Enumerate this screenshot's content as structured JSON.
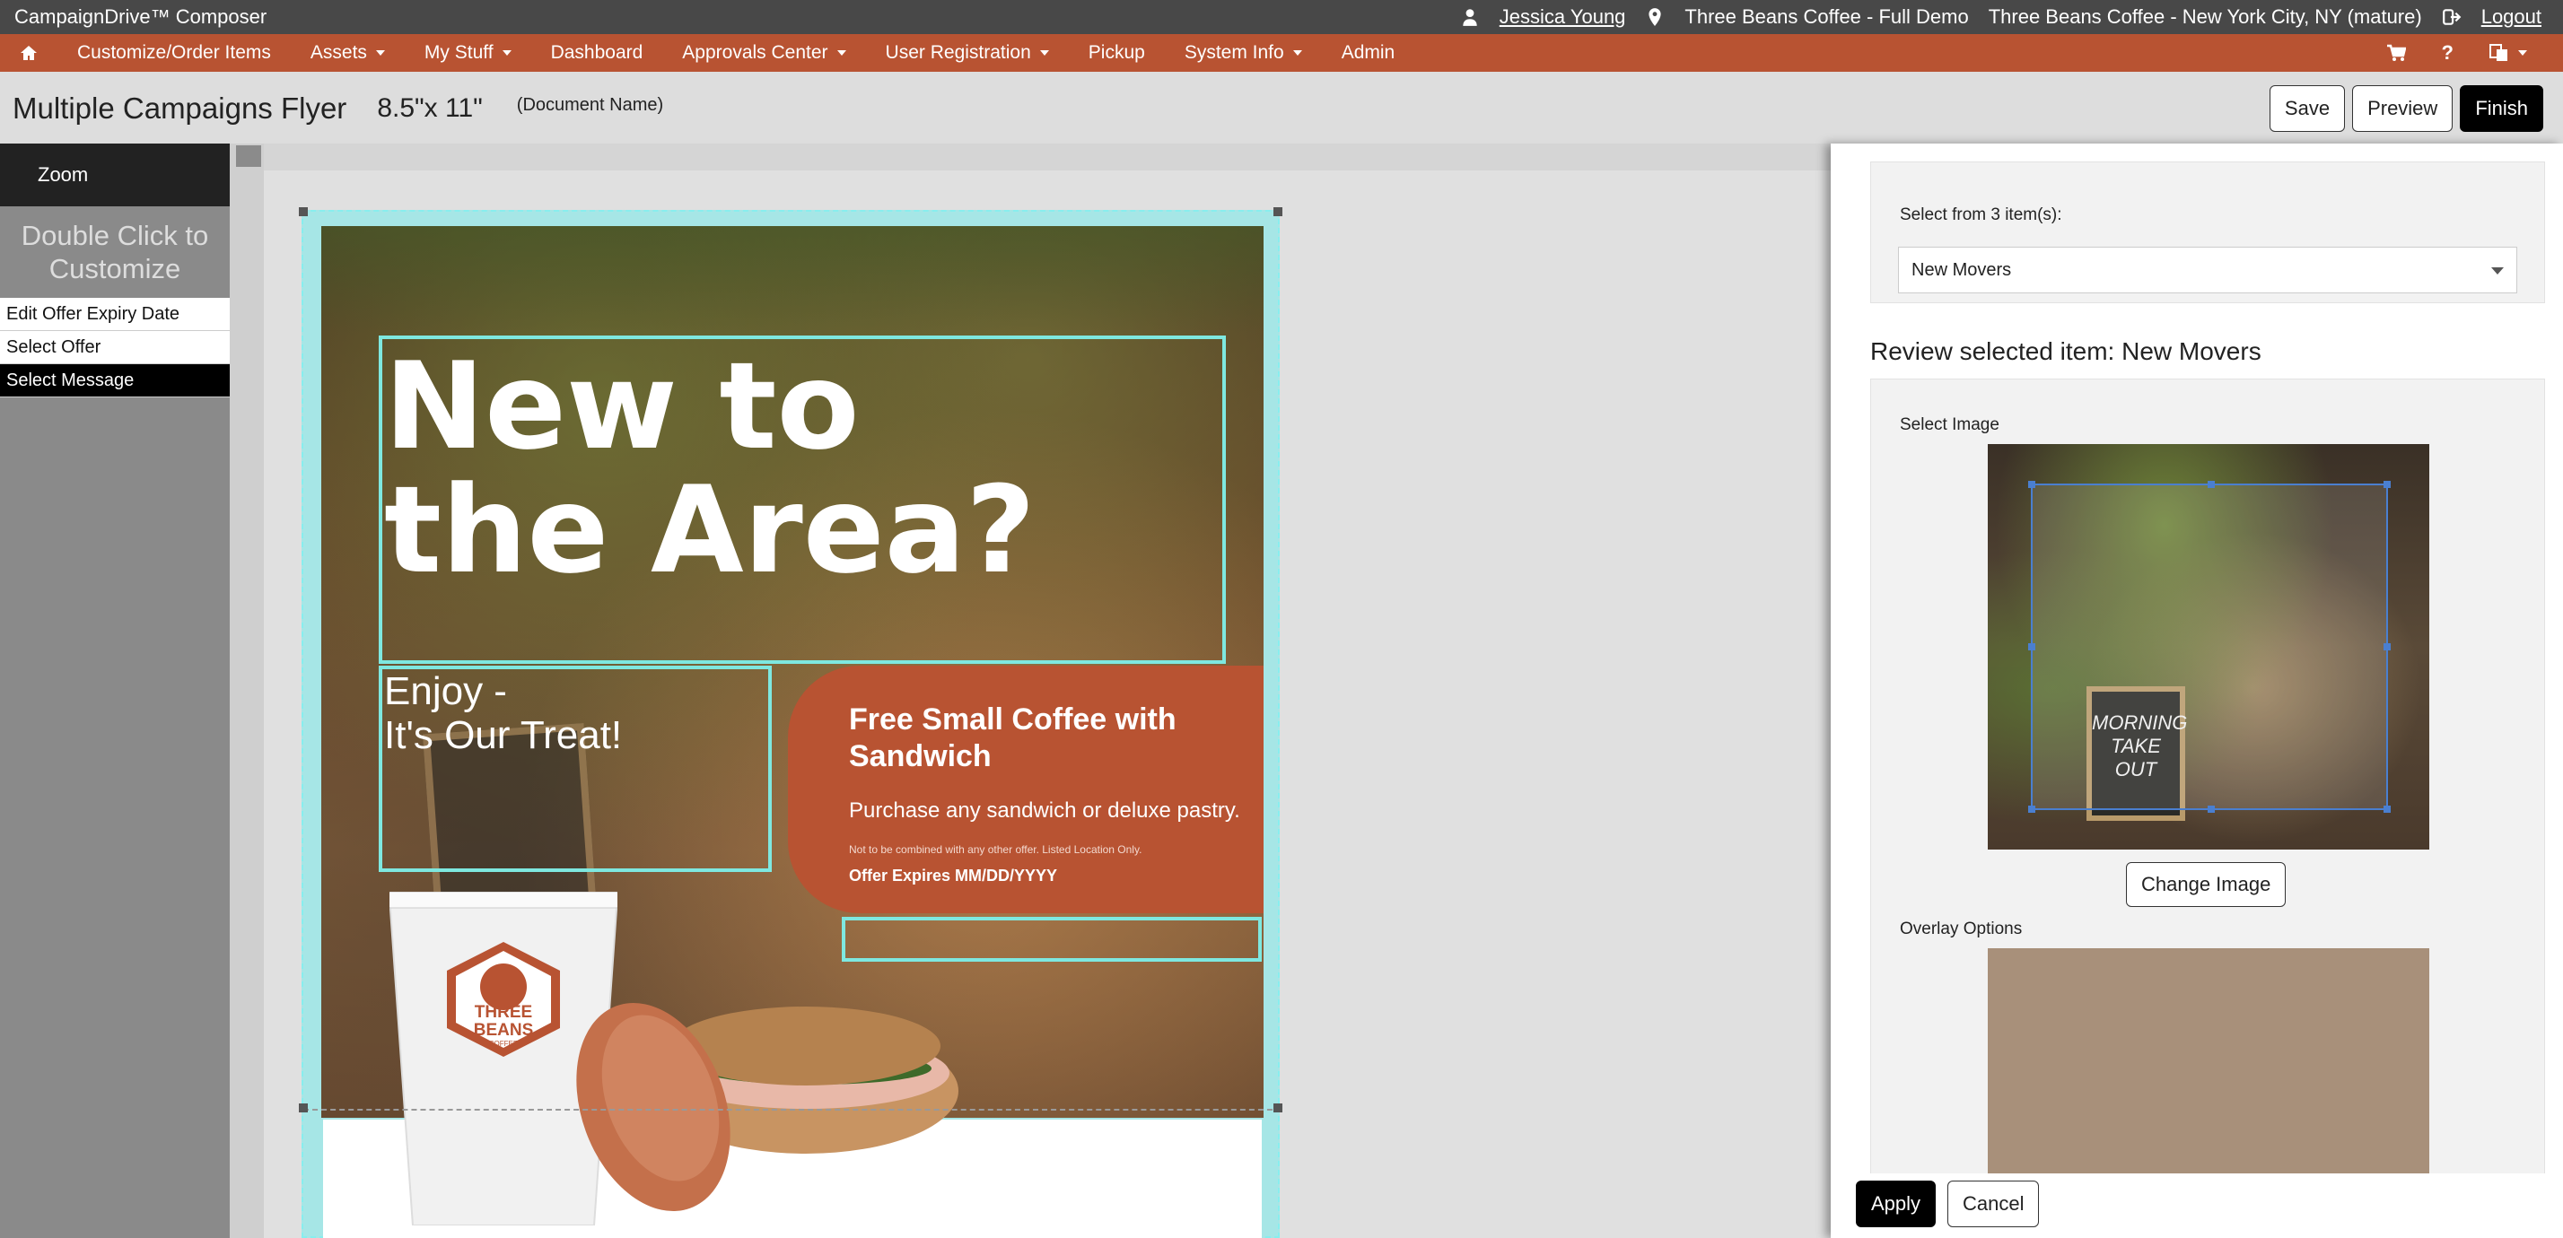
{
  "topbar": {
    "app_title": "CampaignDrive™ Composer",
    "user_name": "Jessica Young",
    "location_name": "Three Beans Coffee - Full Demo",
    "location_detail": "Three Beans Coffee - New York City, NY (mature)",
    "logout_label": "Logout"
  },
  "nav": {
    "items": [
      {
        "label": "Customize/Order Items"
      },
      {
        "label": "Assets"
      },
      {
        "label": "My Stuff"
      },
      {
        "label": "Dashboard"
      },
      {
        "label": "Approvals Center"
      },
      {
        "label": "User Registration"
      },
      {
        "label": "Pickup"
      },
      {
        "label": "System Info"
      },
      {
        "label": "Admin"
      }
    ]
  },
  "document": {
    "title": "Multiple Campaigns Flyer",
    "size": "8.5\"x 11\"",
    "name_placeholder": "(Document Name)"
  },
  "actions": {
    "save": "Save",
    "preview": "Preview",
    "finish": "Finish"
  },
  "leftpanel": {
    "zoom": "Zoom",
    "instruction": "Double Click to Customize",
    "items": [
      {
        "label": "Edit Offer Expiry Date"
      },
      {
        "label": "Select Offer"
      },
      {
        "label": "Select Message"
      }
    ]
  },
  "flyer": {
    "headline": "New to the Area?",
    "enjoy_line1": "Enjoy -",
    "enjoy_line2": "It's Our Treat!",
    "offer_title": "Free Small Coffee with Sandwich",
    "offer_sub": "Purchase any sandwich or deluxe pastry.",
    "offer_fine": "Not to be combined with any other offer. Listed Location Only.",
    "offer_expiry": "Offer Expires MM/DD/YYYY",
    "cup_brand_1": "THREE",
    "cup_brand_2": "BEANS",
    "cup_brand_3": "COFFEE"
  },
  "rightpanel": {
    "select_label": "Select from 3 item(s):",
    "select_value": "New Movers",
    "review_title": "Review selected item: New Movers",
    "image_label": "Select Image",
    "chalk_text": "MORNING TAKE OUT",
    "change_image": "Change Image",
    "overlay_label": "Overlay Options",
    "overlay_color": "#a8907a",
    "apply": "Apply",
    "cancel": "Cancel"
  },
  "colors": {
    "brand_orange": "#b85332",
    "selection_cyan": "#7ee8e0",
    "topbar_gray": "#484848"
  }
}
